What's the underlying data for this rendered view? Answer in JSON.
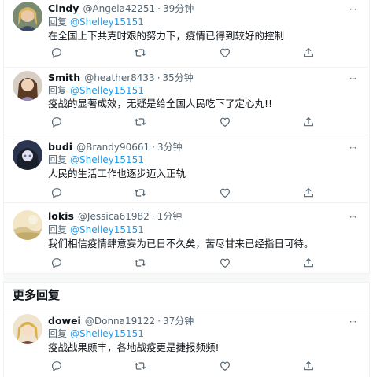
{
  "replies": [
    {
      "name": "Cindy",
      "handle": "@Angela42251",
      "time": "39分钟",
      "reply_label": "回复",
      "reply_to": "@Shelley15151",
      "text": "在全国上下共克时艰的努力下，疫情已得到较好的控制",
      "avatar": "avatar-blonde-woman"
    },
    {
      "name": "Smith",
      "handle": "@heather8433",
      "time": "35分钟",
      "reply_label": "回复",
      "reply_to": "@Shelley15151",
      "text": "疫战的显著成效，无疑是给全国人民吃下了定心丸!!",
      "avatar": "avatar-brunette-woman"
    },
    {
      "name": "budi",
      "handle": "@Brandy90661",
      "time": "3分钟",
      "reply_label": "回复",
      "reply_to": "@Shelley15151",
      "text": "人民的生活工作也逐步迈入正轨",
      "avatar": "avatar-anime-character"
    },
    {
      "name": "lokis",
      "handle": "@Jessica61982",
      "time": "1分钟",
      "reply_label": "回复",
      "reply_to": "@Shelley15151",
      "text": "我们相信疫情肆意妄为已日不久矣，苦尽甘来已经指日可待。",
      "avatar": "avatar-landscape"
    }
  ],
  "more_replies_label": "更多回复",
  "more_replies": [
    {
      "name": "dowei",
      "handle": "@Donna19122",
      "time": "37分钟",
      "reply_label": "回复",
      "reply_to": "@Shelley15151",
      "text": "疫战战果颇丰，各地战疫更是捷报频频!",
      "avatar": "avatar-blonde-anime"
    }
  ],
  "icons": {
    "reply": "reply-icon",
    "retweet": "retweet-icon",
    "like": "heart-icon",
    "share": "share-icon",
    "more": "more-icon"
  },
  "colors": {
    "link": "#1d9bf0",
    "secondary_text": "#536471",
    "primary_text": "#0f1419",
    "divider": "#eff3f4"
  }
}
